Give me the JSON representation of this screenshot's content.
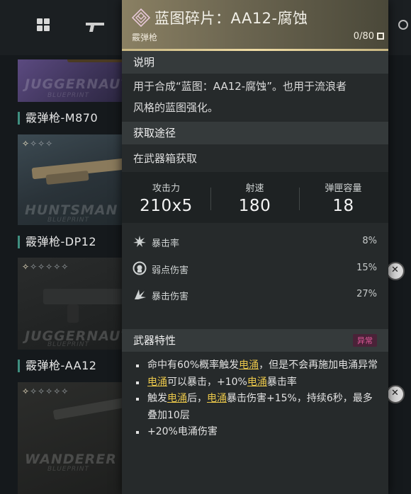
{
  "tooltip": {
    "title": "蓝图碎片：AA12-腐蚀",
    "subtitle": "霰弹枪",
    "count": "0/80",
    "description": {
      "header": "说明",
      "text_line1": "用于合成“蓝图：AA12-腐蚀”。也用于流浪者",
      "text_line2": "风格的蓝图强化。"
    },
    "acquire": {
      "header": "获取途径",
      "text": "在武器箱获取"
    },
    "stats": [
      {
        "label": "攻击力",
        "value": "210x5"
      },
      {
        "label": "射速",
        "value": "180"
      },
      {
        "label": "弹匣容量",
        "value": "18"
      }
    ],
    "substats": [
      {
        "icon": "crit-rate-icon",
        "label": "暴击率",
        "value": "8%"
      },
      {
        "icon": "weakspot-icon",
        "label": "弱点伤害",
        "value": "15%"
      },
      {
        "icon": "crit-damage-icon",
        "label": "暴击伤害",
        "value": "27%"
      }
    ],
    "traits": {
      "header": "武器特性",
      "tag": "异常",
      "items": [
        {
          "pre": "命中有60%概率触发",
          "hl": "电涌",
          "post": "，但是不会再施加电涌异常",
          "hl2": "",
          "post2": ""
        },
        {
          "pre": "",
          "hl": "电涌",
          "post": "可以暴击，+10%",
          "hl2": "电涌",
          "post2": "暴击率"
        },
        {
          "pre": "触发",
          "hl": "电涌",
          "post": "后，",
          "hl2": "电涌",
          "post2": "暴击伤害+15%，持续6秒，最多叠加10层"
        },
        {
          "pre": "+20%电涌伤害",
          "hl": "",
          "post": "",
          "hl2": "",
          "post2": ""
        }
      ]
    }
  },
  "inventory": {
    "cards": [
      {
        "brand": "JUGGERNAUT",
        "brand_sub": "BLUEPRINT",
        "stars": "",
        "title": "霰弹枪-M870"
      },
      {
        "brand": "HUNTSMAN",
        "brand_sub": "BLUEPRINT",
        "stars_filled": "✧",
        "stars_empty": "✧✧✧",
        "title": "霰弹枪-DP12"
      },
      {
        "brand": "JUGGERNAUT",
        "brand_sub": "BLUEPRINT",
        "stars_filled": "✧",
        "stars_empty": "✧✧✧✧✧",
        "title": "霰弹枪-AA12"
      },
      {
        "brand": "WANDERER",
        "brand_sub": "BLUEPRINT",
        "stars_filled": "✧",
        "stars_empty": "✧✧✧✧✧"
      }
    ]
  },
  "colors": {
    "highlight": "#e9c64a",
    "tag": "#e05a9a",
    "header_gold": "#f0dca4",
    "title_accent": "#3f8f80"
  }
}
